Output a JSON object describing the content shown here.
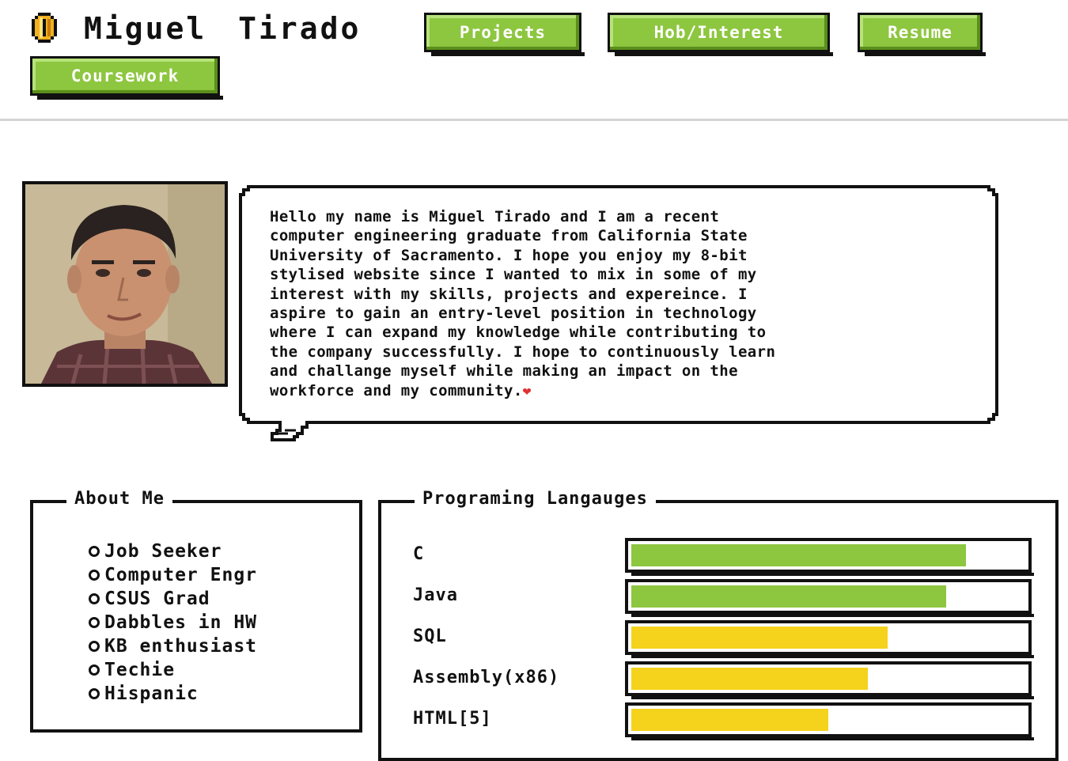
{
  "header": {
    "title": "Miguel Tirado",
    "nav": [
      {
        "label": "Projects"
      },
      {
        "label": "Hob/Interest"
      },
      {
        "label": "Resume"
      },
      {
        "label": "Coursework"
      }
    ]
  },
  "bio": {
    "text": "Hello my name is Miguel Tirado and I am a recent\ncomputer engineering graduate from California State\nUniversity of Sacramento. I hope you enjoy my 8-bit\nstylised website since I wanted to mix in some of my\ninterest with my skills, projects and expereince. I\naspire to gain an entry-level position in technology\nwhere I can expand my knowledge while contributing to\nthe company successfully. I hope to continuously learn\nand challange myself while making an impact on the\nworkforce and my community.",
    "emoji": "❤"
  },
  "about": {
    "title": "About Me",
    "items": [
      "Job Seeker",
      "Computer Engr",
      "CSUS Grad",
      "Dabbles in HW",
      "KB enthusiast",
      "Techie",
      "Hispanic"
    ]
  },
  "languages": {
    "title": "Programing Langauges",
    "items": [
      {
        "name": "C",
        "level": 0.85,
        "color": "#8dc63f"
      },
      {
        "name": "Java",
        "level": 0.8,
        "color": "#8dc63f"
      },
      {
        "name": "SQL",
        "level": 0.65,
        "color": "#f5d21c"
      },
      {
        "name": "Assembly(x86)",
        "level": 0.6,
        "color": "#f5d21c"
      },
      {
        "name": "HTML[5]",
        "level": 0.5,
        "color": "#f5d21c"
      }
    ]
  },
  "colors": {
    "accent": "#8dc63f",
    "accent_dark": "#5a8f1c",
    "yellow": "#f5d21c",
    "border": "#111111"
  }
}
